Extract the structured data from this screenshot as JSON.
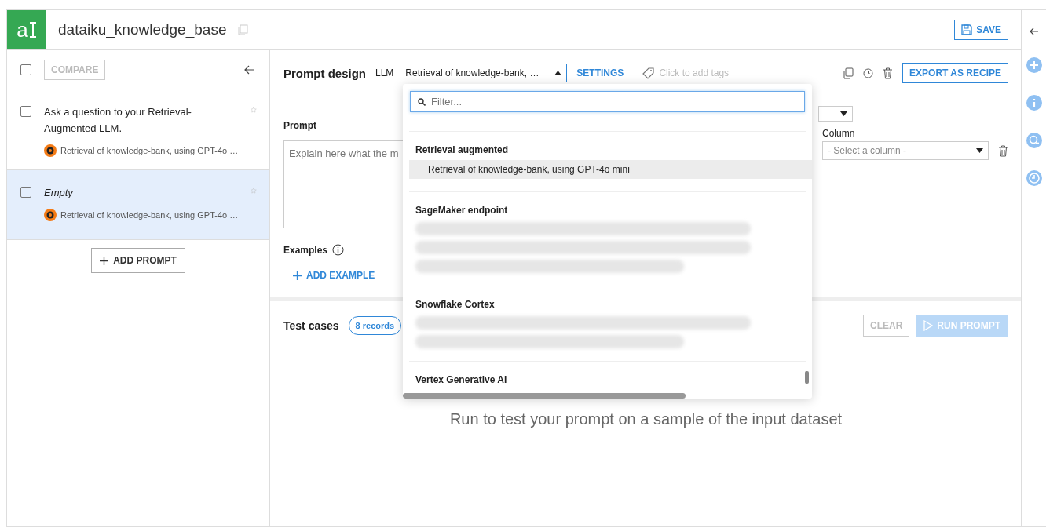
{
  "header": {
    "logo_letter": "a",
    "title": "dataiku_knowledge_base",
    "save": "SAVE"
  },
  "sidebar": {
    "compare": "COMPARE",
    "compare_checked": false,
    "prompts": [
      {
        "title": "Ask a question to your Retrieval-Augmented LLM.",
        "italic": false,
        "model": "Retrieval of knowledge-bank, using GPT-4o …",
        "checked": false,
        "starred": false,
        "selected": false
      },
      {
        "title": "Empty",
        "italic": true,
        "model": "Retrieval of knowledge-bank, using GPT-4o …",
        "checked": false,
        "starred": false,
        "selected": true
      }
    ],
    "add_prompt": "ADD PROMPT"
  },
  "design": {
    "title": "Prompt design",
    "llm_label": "LLM",
    "llm_value": "Retrieval of knowledge-bank, …",
    "expanded": true,
    "settings": "SETTINGS",
    "tags_placeholder": "Click to add tags",
    "export": "EXPORT AS RECIPE",
    "prompt_label": "Prompt",
    "prompt_placeholder": "Explain here what the m",
    "column_label": "Column",
    "column_placeholder": "- Select a column -",
    "examples_label": "Examples",
    "add_example": "ADD EXAMPLE"
  },
  "test_cases": {
    "title": "Test cases",
    "records": "8 records",
    "clear": "CLEAR",
    "run": "RUN PROMPT",
    "run_disabled": true,
    "empty_message": "Run to test your prompt on a sample of the input dataset"
  },
  "dropdown": {
    "filter_placeholder": "Filter...",
    "groups": [
      {
        "name": "Retrieval augmented",
        "items": [
          {
            "label": "Retrieval of knowledge-bank, using GPT-4o mini",
            "selected": true
          }
        ]
      },
      {
        "name": "SageMaker endpoint",
        "blurred": true
      },
      {
        "name": "Snowflake Cortex",
        "blurred": true
      },
      {
        "name": "Vertex Generative AI"
      }
    ]
  }
}
